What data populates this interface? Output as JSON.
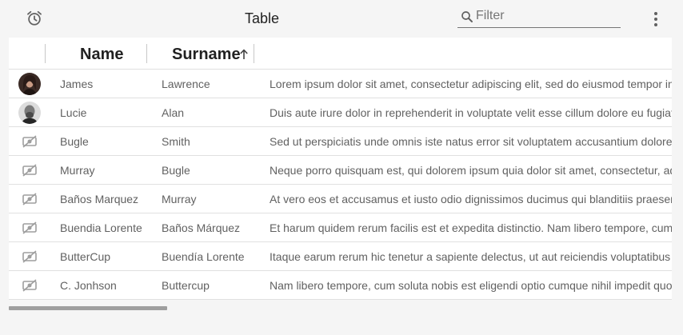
{
  "toolbar": {
    "title": "Table",
    "filter_placeholder": "Filter",
    "filter_value": ""
  },
  "table": {
    "columns": [
      {
        "label": "Name"
      },
      {
        "label": "Surname",
        "sort": "ascending"
      },
      {
        "label": ""
      }
    ],
    "rows": [
      {
        "avatar": "photo",
        "name": "James",
        "surname": "Lawrence",
        "description": "Lorem ipsum dolor sit amet, consectetur adipiscing elit, sed do eiusmod tempor incididunt ut labore et dolore magna aliqua."
      },
      {
        "avatar": "photo",
        "name": "Lucie",
        "surname": "Alan",
        "description": "Duis aute irure dolor in reprehenderit in voluptate velit esse cillum dolore eu fugiat nulla pariatur."
      },
      {
        "avatar": "no-image-icon",
        "name": "Bugle",
        "surname": "Smith",
        "description": "Sed ut perspiciatis unde omnis iste natus error sit voluptatem accusantium doloremque laudantium."
      },
      {
        "avatar": "no-image-icon",
        "name": "Murray",
        "surname": "Bugle",
        "description": "Neque porro quisquam est, qui dolorem ipsum quia dolor sit amet, consectetur, adipisci velit."
      },
      {
        "avatar": "no-image-icon",
        "name": "Baños Marquez",
        "surname": "Murray",
        "description": "At vero eos et accusamus et iusto odio dignissimos ducimus qui blanditiis praesentium voluptatum."
      },
      {
        "avatar": "no-image-icon",
        "name": "Buendia Lorente",
        "surname": "Baños Márquez",
        "description": "Et harum quidem rerum facilis est et expedita distinctio. Nam libero tempore, cum soluta nobis."
      },
      {
        "avatar": "no-image-icon",
        "name": "ButterCup",
        "surname": "Buendía Lorente",
        "description": "Itaque earum rerum hic tenetur a sapiente delectus, ut aut reiciendis voluptatibus maiores alias."
      },
      {
        "avatar": "no-image-icon",
        "name": "C. Jonhson",
        "surname": "Buttercup",
        "description": "Nam libero tempore, cum soluta nobis est eligendi optio cumque nihil impedit quo minus id quod."
      }
    ]
  },
  "colors": {
    "background": "#f5f5f5",
    "surface": "#ffffff",
    "divider": "#e0e0e0",
    "text_primary": "#212121",
    "text_secondary": "#616161",
    "scrollbar": "#9e9e9e"
  },
  "icons": {
    "toolbar_left": "alarm-clock-icon",
    "filter": "search-icon",
    "toolbar_right": "more-vertical-icon",
    "sort": "arrow-up-icon",
    "missing_avatar": "no-image-icon"
  }
}
